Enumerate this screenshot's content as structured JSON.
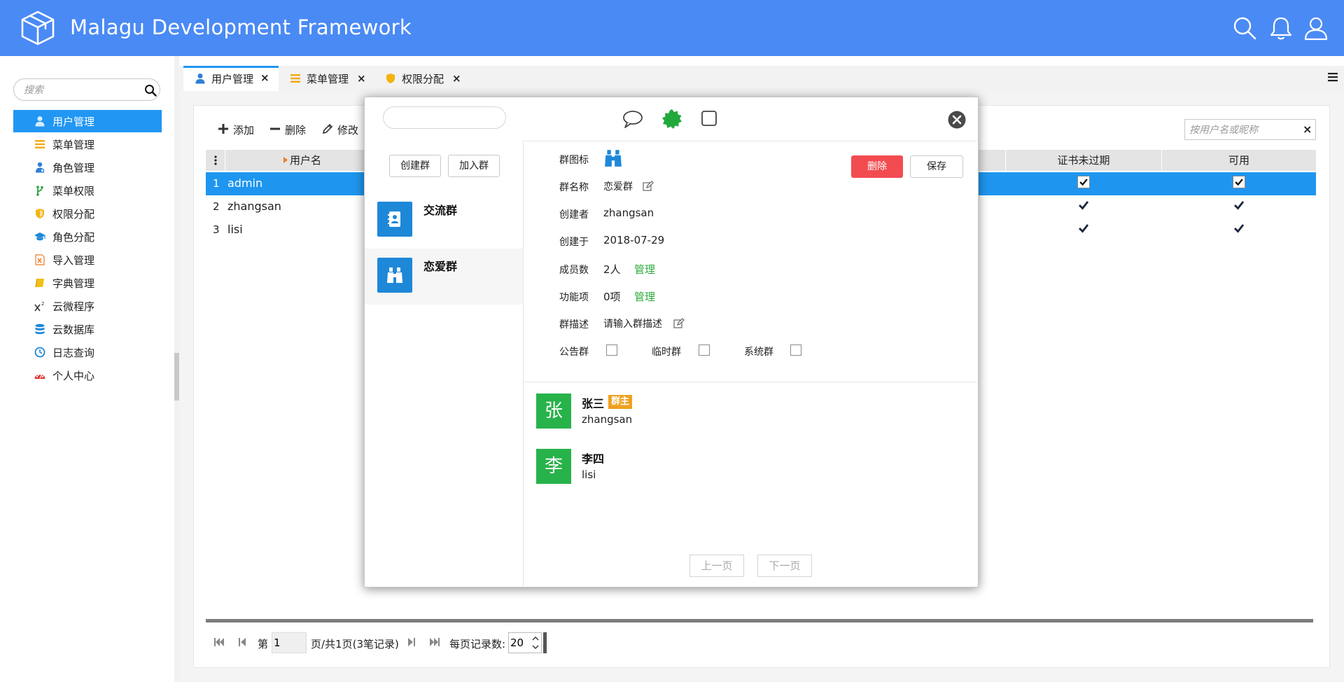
{
  "app": {
    "title": "Malagu Development Framework"
  },
  "header_icons": [
    "search-icon",
    "bell-icon",
    "user-icon"
  ],
  "sidebar": {
    "search_placeholder": "搜索",
    "items": [
      {
        "label": "用户管理",
        "icon": "user-icon",
        "active": true
      },
      {
        "label": "菜单管理",
        "icon": "menu-lines-icon"
      },
      {
        "label": "角色管理",
        "icon": "users-role-icon"
      },
      {
        "label": "菜单权限",
        "icon": "branch-icon"
      },
      {
        "label": "权限分配",
        "icon": "shield-icon"
      },
      {
        "label": "角色分配",
        "icon": "graduation-cap-icon"
      },
      {
        "label": "导入管理",
        "icon": "excel-file-icon"
      },
      {
        "label": "字典管理",
        "icon": "book-icon"
      },
      {
        "label": "云微程序",
        "icon": "superscript-icon"
      },
      {
        "label": "云数据库",
        "icon": "database-icon"
      },
      {
        "label": "日志查询",
        "icon": "clock-icon"
      },
      {
        "label": "个人中心",
        "icon": "dashboard-icon"
      }
    ]
  },
  "tabs": [
    {
      "label": "用户管理",
      "close": "×",
      "icon": "user-icon",
      "active": true
    },
    {
      "label": "菜单管理",
      "close": "×",
      "icon": "menu-lines-icon"
    },
    {
      "label": "权限分配",
      "close": "×",
      "icon": "shield-icon"
    }
  ],
  "toolbar": {
    "add": "添加",
    "delete": "删除",
    "edit": "修改",
    "search_placeholder": "按用户名或昵称",
    "clear": "×"
  },
  "grid": {
    "columns": {
      "username": "用户名",
      "cert": "证书未过期",
      "enabled": "可用"
    },
    "rows": [
      {
        "num": "1",
        "name": "admin",
        "cert": true,
        "enabled": true,
        "selected": true
      },
      {
        "num": "2",
        "name": "zhangsan",
        "cert": true,
        "enabled": true
      },
      {
        "num": "3",
        "name": "lisi",
        "cert": true,
        "enabled": true
      }
    ]
  },
  "pager": {
    "page_prefix": "第",
    "page": "1",
    "page_suffix": "页/共1页(3笔记录)",
    "size_label": "每页记录数:",
    "page_size": "20"
  },
  "dialog": {
    "create_group": "创建群",
    "join_group": "加入群",
    "groups": [
      {
        "name": "交流群",
        "icon": "contact-book-icon"
      },
      {
        "name": "恋爱群",
        "icon": "binoculars-icon",
        "selected": true
      }
    ],
    "fields": {
      "icon_label": "群图标",
      "name_label": "群名称",
      "name_value": "恋爱群",
      "creator_label": "创建者",
      "creator_value": "zhangsan",
      "created_label": "创建于",
      "created_value": "2018-07-29",
      "members_label": "成员数",
      "members_value": "2人",
      "members_link": "管理",
      "functions_label": "功能项",
      "functions_value": "0项",
      "functions_link": "管理",
      "desc_label": "群描述",
      "desc_value": "请输入群描述"
    },
    "flags": {
      "public_label": "公告群",
      "temp_label": "临时群",
      "system_label": "系统群"
    },
    "delete_button": "删除",
    "save_button": "保存",
    "members": [
      {
        "avatar": "张",
        "name": "张三",
        "id": "zhangsan",
        "badge": "群主",
        "color": "#28b24a"
      },
      {
        "avatar": "李",
        "name": "李四",
        "id": "lisi",
        "color": "#28b24a"
      }
    ],
    "prev": "上一页",
    "next": "下一页"
  },
  "colors": {
    "header": "#4a8af4",
    "accent": "#2196f3",
    "selected_row": "#1e96f0",
    "danger": "#f24c51",
    "success": "#2bab3b",
    "owner_badge": "#f0a020"
  }
}
